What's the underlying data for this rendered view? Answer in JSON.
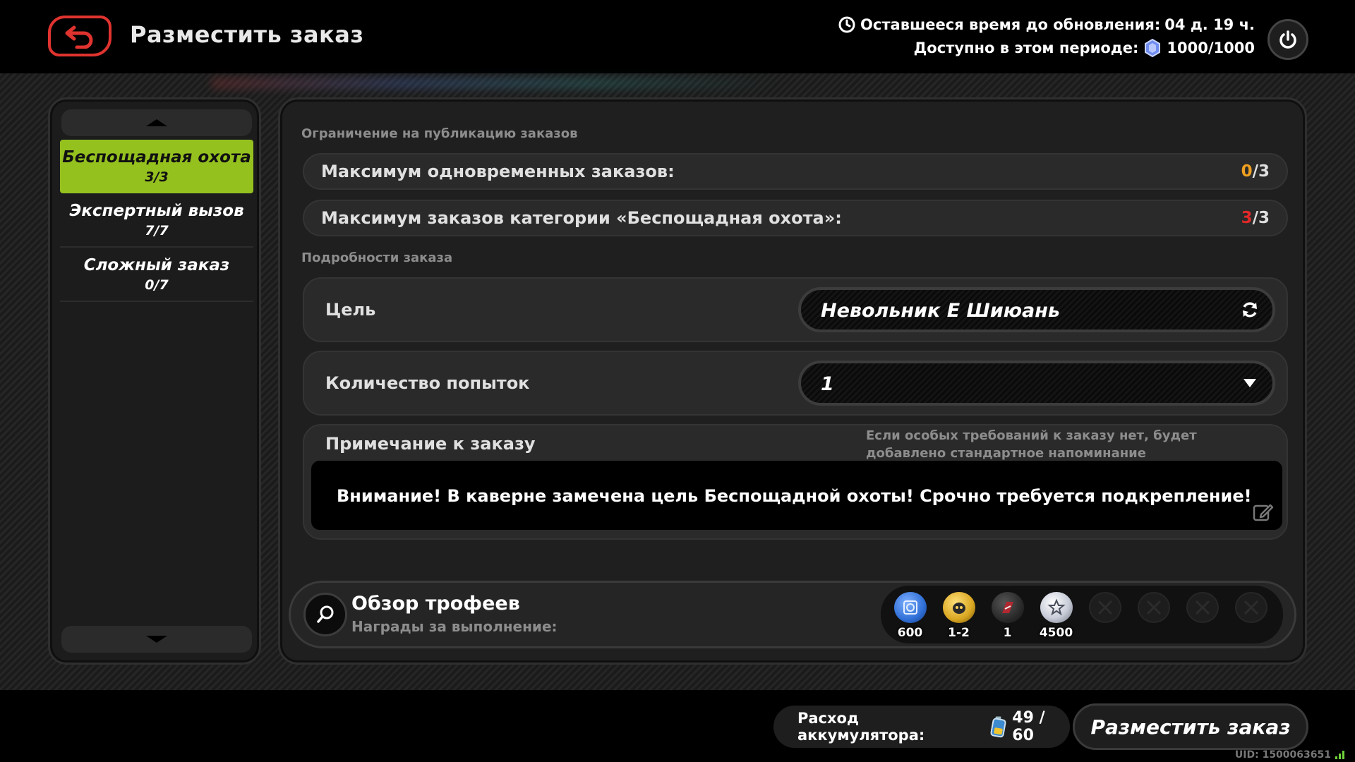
{
  "header": {
    "title": "Разместить заказ",
    "timer_label": "Оставшееся время до обновления:",
    "timer_value": "04 д. 19 ч.",
    "period_label": "Доступно в этом периоде:",
    "period_value": "1000/1000"
  },
  "categories": [
    {
      "name": "Беспощадная охота",
      "count": "3/3",
      "active": true
    },
    {
      "name": "Экспертный вызов",
      "count": "7/7",
      "active": false
    },
    {
      "name": "Сложный заказ",
      "count": "0/7",
      "active": false
    }
  ],
  "limits": {
    "section_label": "Ограничение на публикацию заказов",
    "rows": [
      {
        "label": "Максимум одновременных заказов:",
        "current": "0",
        "max": "/3",
        "current_color": "#f0a020"
      },
      {
        "label": "Максимум заказов категории «Беспощадная охота»:",
        "current": "3",
        "max": "/3",
        "current_color": "#e02828"
      }
    ]
  },
  "details": {
    "section_label": "Подробности заказа",
    "target": {
      "label": "Цель",
      "value": "Невольник Е Шиюань",
      "icon": "refresh-icon"
    },
    "attempts": {
      "label": "Количество попыток",
      "value": "1",
      "icon": "dropdown-arrow-icon"
    },
    "note": {
      "label": "Примечание к заказу",
      "hint": "Если особых требований к заказу нет, будет добавлено стандартное напоминание",
      "text": "Внимание! В каверне замечена цель Беспощадной охоты! Срочно требуется подкрепление!"
    }
  },
  "trophies": {
    "title": "Обзор трофеев",
    "subtitle": "Награды за выполнение:",
    "rewards": [
      {
        "qty": "600",
        "icon": "blue-chip-icon",
        "color": "#2f6fd6"
      },
      {
        "qty": "1-2",
        "icon": "gold-bangboo-icon",
        "color": "#d8a520"
      },
      {
        "qty": "1",
        "icon": "red-drive-icon",
        "color": "#b02830"
      },
      {
        "qty": "4500",
        "icon": "silver-coin-icon",
        "color": "#c8ccd8"
      }
    ],
    "empty_slots": 4
  },
  "footer": {
    "cost_label": "Расход аккумулятора:",
    "cost_value": "49 / 60",
    "submit_label": "Разместить заказ",
    "uid": "UID: 1500063651"
  },
  "colors": {
    "accent_active": "#95c11f",
    "back_red": "#e0332f"
  }
}
